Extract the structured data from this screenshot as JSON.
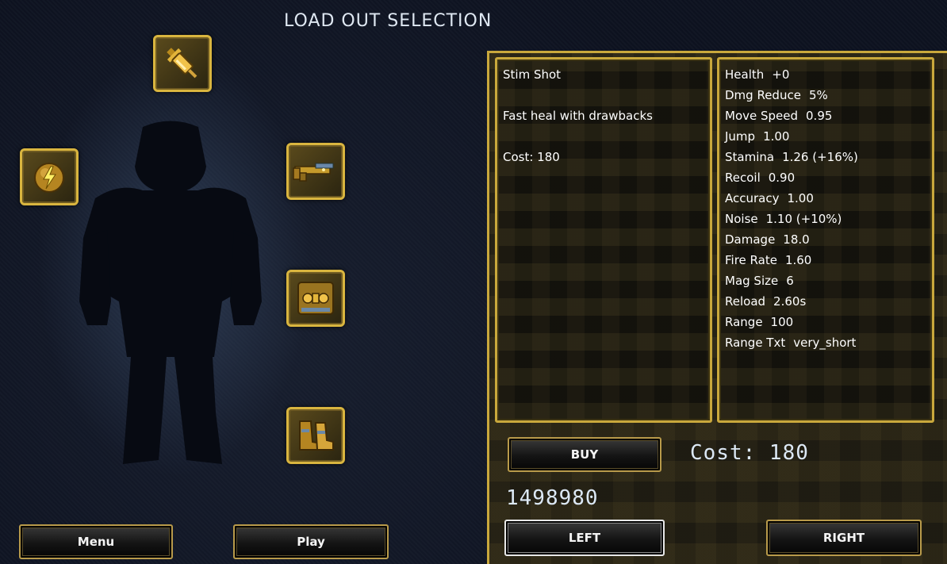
{
  "screen": {
    "title": "LOAD OUT SELECTION"
  },
  "colors": {
    "gold_border": "#d9b53f",
    "text": "#ffffff",
    "digital_text": "#dce8f5"
  },
  "loadout_slots": [
    {
      "name": "stim-shot",
      "icon": "syringe-icon"
    },
    {
      "name": "grenade",
      "icon": "lightning-grenade-icon"
    },
    {
      "name": "primary-weapon",
      "icon": "shotgun-icon"
    },
    {
      "name": "armor",
      "icon": "armor-plate-icon"
    },
    {
      "name": "boots",
      "icon": "boots-icon"
    }
  ],
  "item": {
    "name": "Stim Shot",
    "description": "Fast heal with drawbacks",
    "cost_line": "Cost: 180"
  },
  "stats": [
    {
      "label": "Health",
      "value": "+0"
    },
    {
      "label": "Dmg Reduce",
      "value": "5%"
    },
    {
      "label": "Move Speed",
      "value": "0.95"
    },
    {
      "label": "Jump",
      "value": "1.00"
    },
    {
      "label": "Stamina",
      "value": "1.26 (+16%)"
    },
    {
      "label": "Recoil",
      "value": "0.90"
    },
    {
      "label": "Accuracy",
      "value": "1.00"
    },
    {
      "label": "Noise",
      "value": "1.10 (+10%)"
    },
    {
      "label": "Damage",
      "value": "18.0"
    },
    {
      "label": "Fire Rate",
      "value": "1.60"
    },
    {
      "label": "Mag Size",
      "value": "6"
    },
    {
      "label": "Reload",
      "value": "2.60s"
    },
    {
      "label": "Range",
      "value": "100"
    },
    {
      "label": "Range Txt",
      "value": "very_short"
    }
  ],
  "purchase": {
    "buy_label": "BUY",
    "cost_display": "Cost: 180",
    "money": "1498980"
  },
  "navigation": {
    "left_label": "LEFT",
    "right_label": "RIGHT",
    "menu_label": "Menu",
    "play_label": "Play"
  }
}
